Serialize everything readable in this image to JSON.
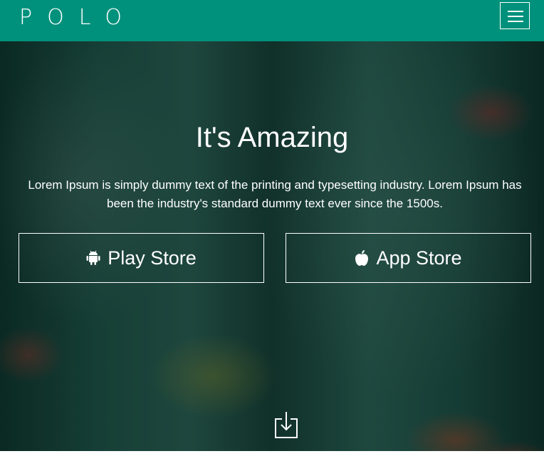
{
  "header": {
    "logo": "POLO",
    "menu_icon": "hamburger-icon"
  },
  "hero": {
    "title": "It's Amazing",
    "text": "Lorem Ipsum is simply dummy text of the printing and typesetting industry. Lorem Ipsum has been the industry's standard dummy text ever since the 1500s.",
    "buttons": [
      {
        "label": "Play Store",
        "icon": "android-icon"
      },
      {
        "label": "App Store",
        "icon": "apple-icon"
      }
    ],
    "scroll_icon": "download-arrow-icon"
  },
  "colors": {
    "brand": "#00917c",
    "text": "#ffffff"
  }
}
